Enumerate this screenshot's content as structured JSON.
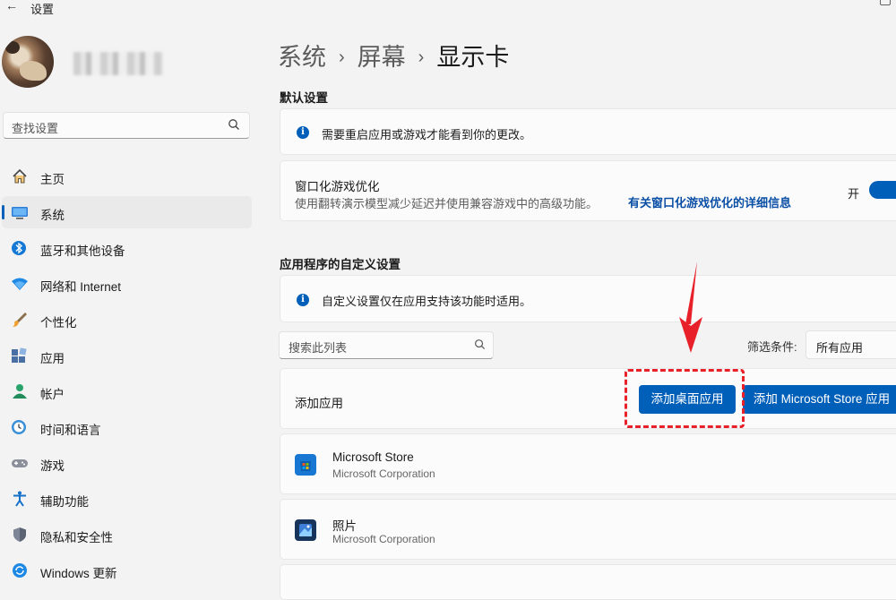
{
  "window": {
    "title": "设置"
  },
  "sidebar": {
    "search_placeholder": "查找设置",
    "items": [
      {
        "label": "主页",
        "icon": "home-icon"
      },
      {
        "label": "系统",
        "icon": "system-display-icon",
        "active": true
      },
      {
        "label": "蓝牙和其他设备",
        "icon": "bluetooth-icon"
      },
      {
        "label": "网络和 Internet",
        "icon": "wifi-icon"
      },
      {
        "label": "个性化",
        "icon": "brush-icon"
      },
      {
        "label": "应用",
        "icon": "apps-icon"
      },
      {
        "label": "帐户",
        "icon": "account-icon"
      },
      {
        "label": "时间和语言",
        "icon": "clock-globe-icon"
      },
      {
        "label": "游戏",
        "icon": "gamepad-icon"
      },
      {
        "label": "辅助功能",
        "icon": "accessibility-icon"
      },
      {
        "label": "隐私和安全性",
        "icon": "shield-icon"
      },
      {
        "label": "Windows 更新",
        "icon": "update-icon"
      }
    ]
  },
  "breadcrumb": {
    "part1": "系统",
    "part2": "屏幕",
    "current": "显示卡"
  },
  "default_settings": {
    "heading": "默认设置",
    "info": "需要重启应用或游戏才能看到你的更改。",
    "windowed_opt": {
      "title": "窗口化游戏优化",
      "desc": "使用翻转演示模型减少延迟并使用兼容游戏中的高级功能。",
      "link": "有关窗口化游戏优化的详细信息",
      "toggle_label": "开",
      "toggle_on": true
    }
  },
  "app_custom": {
    "heading": "应用程序的自定义设置",
    "info": "自定义设置仅在应用支持该功能时适用。",
    "search_placeholder": "搜索此列表",
    "filter_label": "筛选条件:",
    "filter_value": "所有应用",
    "add_label": "添加应用",
    "add_desktop_btn": "添加桌面应用",
    "add_store_btn": "添加 Microsoft Store 应用",
    "apps": [
      {
        "name": "Microsoft Store",
        "publisher": "Microsoft Corporation",
        "icon": "microsoft-store-icon"
      },
      {
        "name": "照片",
        "publisher": "Microsoft Corporation",
        "icon": "photos-icon"
      }
    ]
  },
  "colors": {
    "accent": "#005fb8",
    "annotation": "#e8202a"
  }
}
